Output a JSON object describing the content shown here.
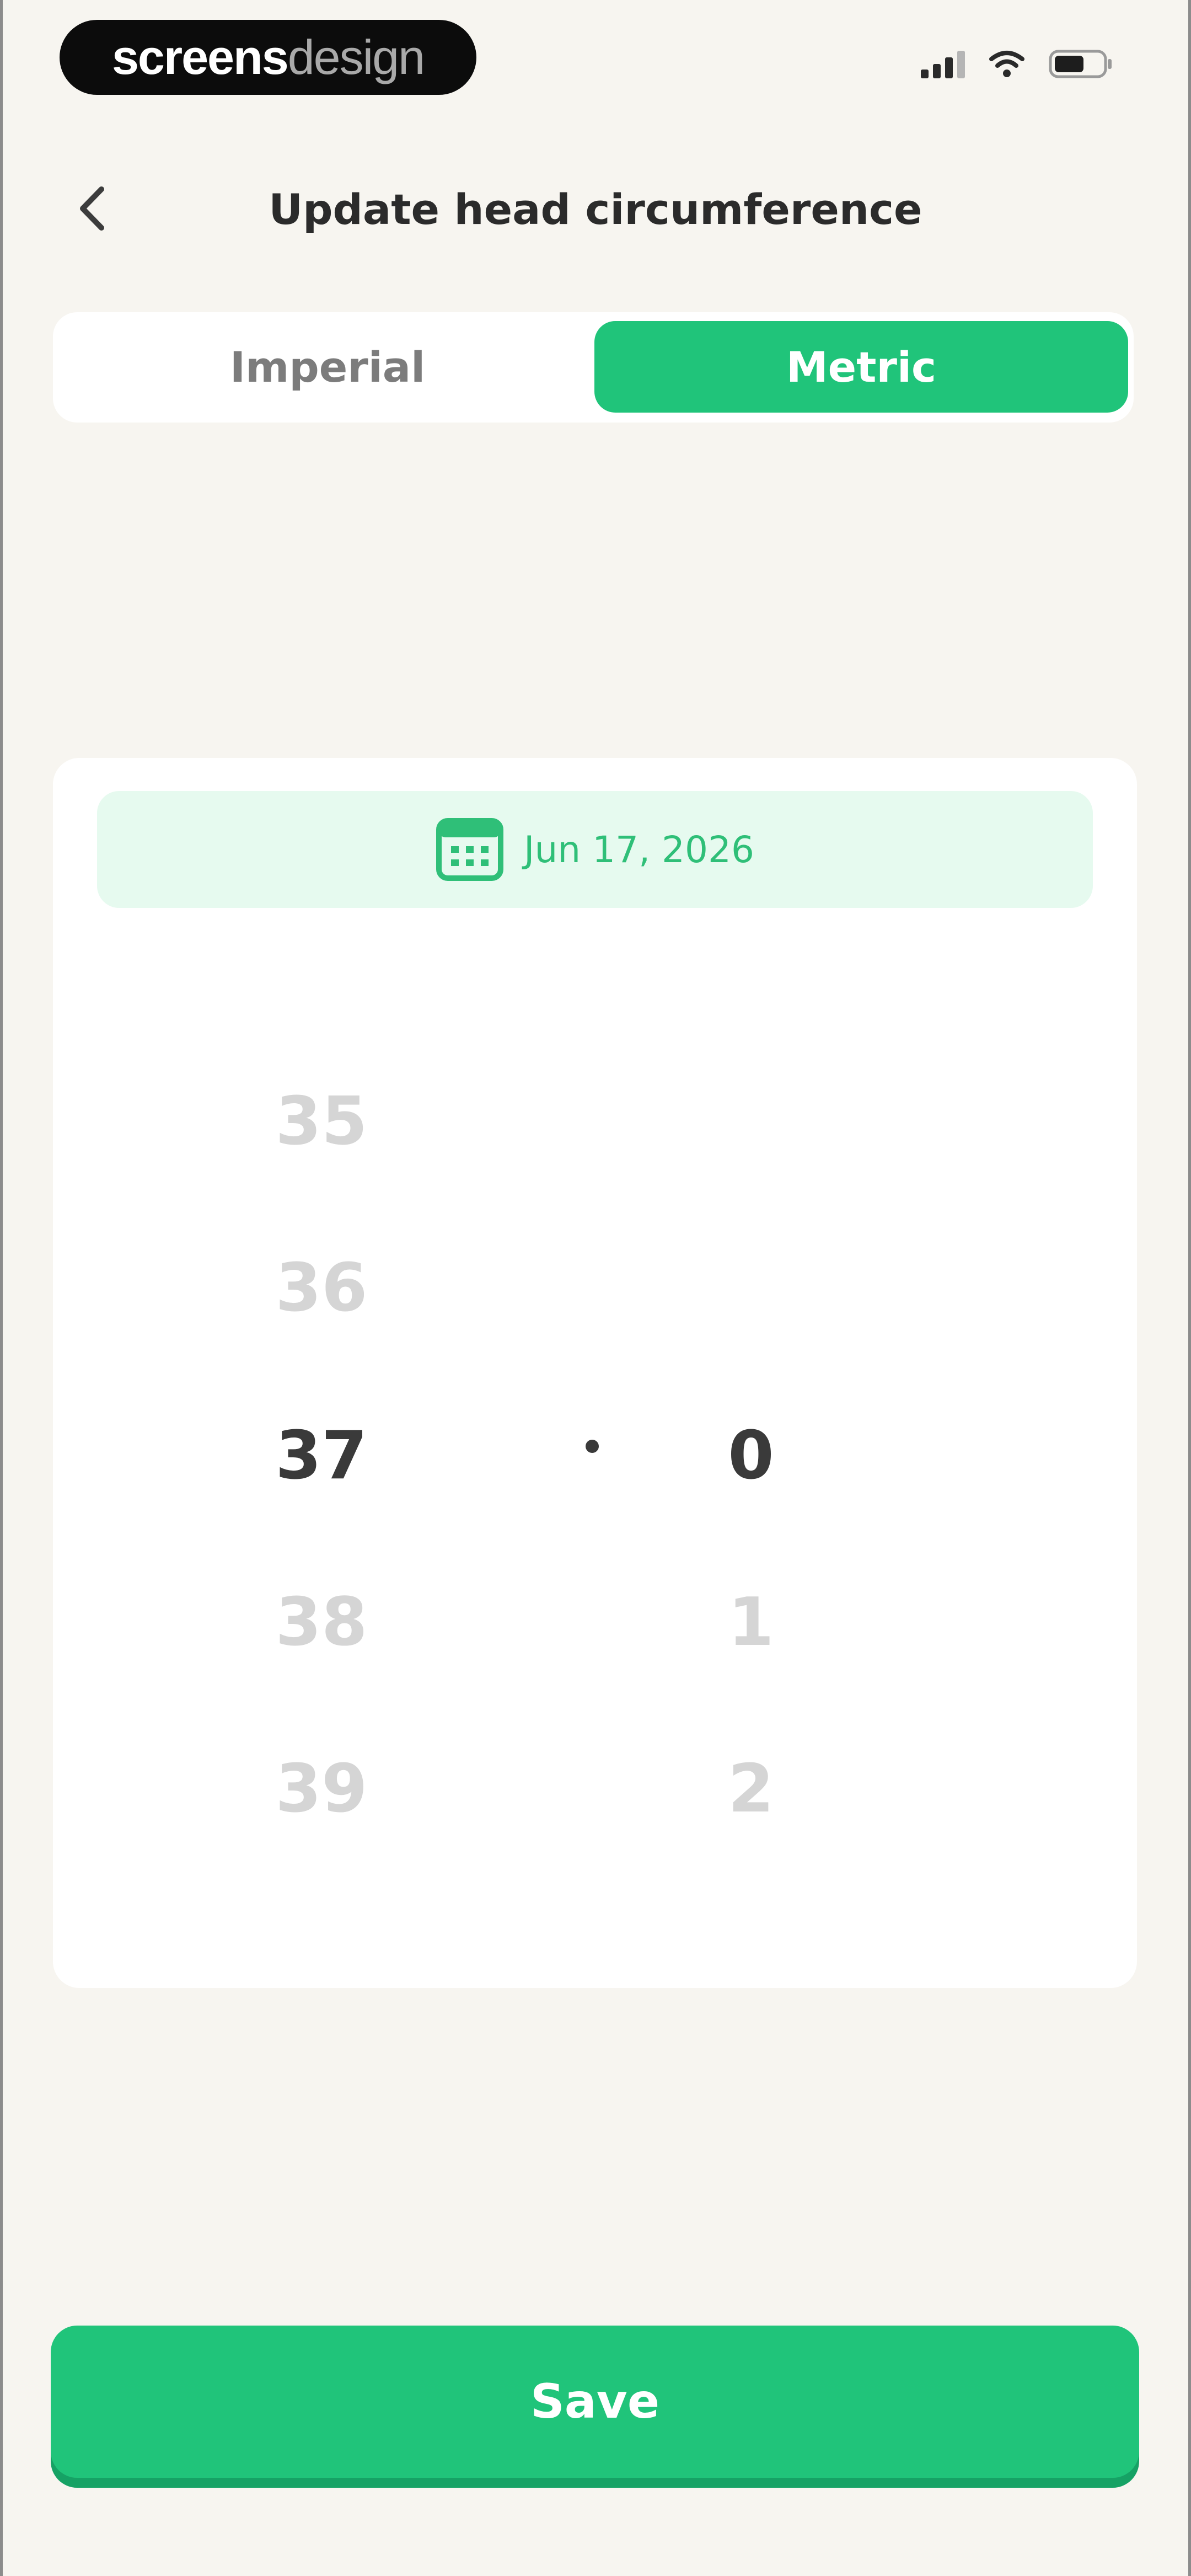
{
  "status_bar": {
    "brand_part1": "screens",
    "brand_part2": "design",
    "icons": [
      "signal-icon",
      "wifi-icon",
      "battery-icon"
    ]
  },
  "header": {
    "title": "Update head circumference",
    "back_icon": "chevron-left-icon"
  },
  "unit_toggle": {
    "options": [
      "Imperial",
      "Metric"
    ],
    "selected": "Metric"
  },
  "date_picker": {
    "icon": "calendar-icon",
    "value": "Jun 17, 2026"
  },
  "measurement_picker": {
    "integer_values": [
      "35",
      "36",
      "37",
      "38",
      "39"
    ],
    "integer_selected": "37",
    "separator": ".",
    "decimal_values": [
      "0",
      "1",
      "2"
    ],
    "decimal_selected": "0"
  },
  "save_button": {
    "label": "Save"
  },
  "colors": {
    "accent": "#20c47a",
    "background": "#f7f5f0",
    "date_chip": "#e6faef",
    "muted_text": "#d5d5d5"
  }
}
